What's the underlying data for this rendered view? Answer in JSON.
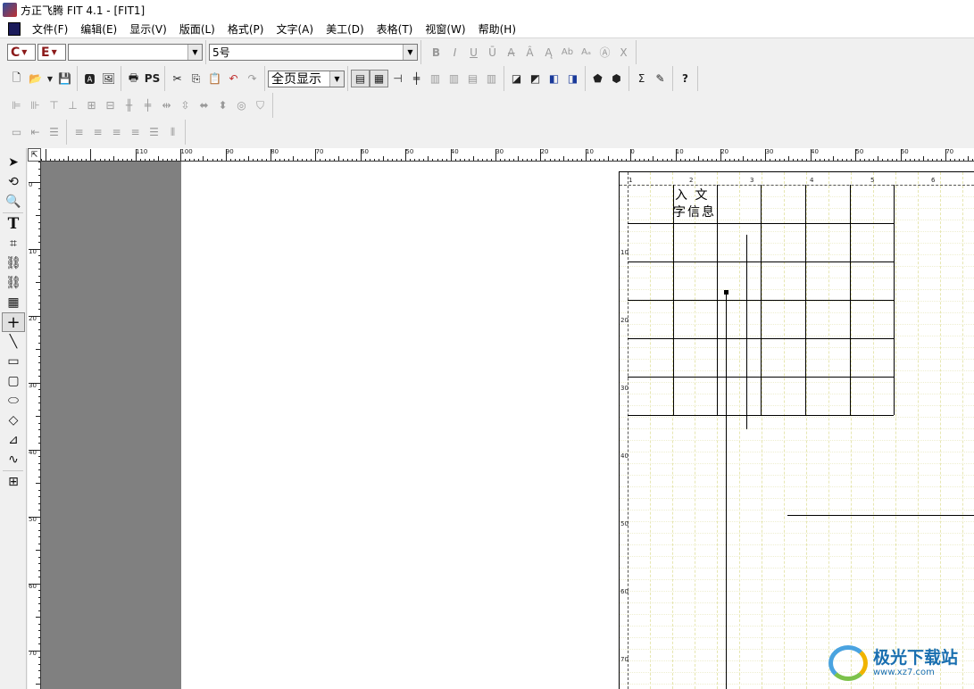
{
  "window": {
    "title": "方正飞腾 FIT 4.1 - [FIT1]"
  },
  "menu": [
    "文件(F)",
    "编辑(E)",
    "显示(V)",
    "版面(L)",
    "格式(P)",
    "文字(A)",
    "美工(D)",
    "表格(T)",
    "视窗(W)",
    "帮助(H)"
  ],
  "format_bar": {
    "lang_c": "C",
    "lang_e": "E",
    "font_name": "",
    "font_size": "5号",
    "style_buttons": [
      "B",
      "I",
      "U",
      "Ū",
      "A̶",
      "Â",
      "Ą",
      "Ab",
      "Aₐ",
      "Ⓐ",
      "X"
    ]
  },
  "main_bar": {
    "ps_label": "PS",
    "view_mode": "全页显示"
  },
  "table_text": [
    "入 文",
    "字信息"
  ],
  "hruler_labels": [
    "110",
    "100",
    "90",
    "80",
    "70",
    "60",
    "50",
    "40",
    "30",
    "20",
    "10",
    "0",
    "10",
    "20",
    "30",
    "40",
    "50",
    "60",
    "70"
  ],
  "vruler_labels": [
    "0",
    "10",
    "20",
    "30",
    "40",
    "50",
    "60",
    "70"
  ],
  "page_hruler_labels": [
    "1",
    "2",
    "3",
    "4",
    "5",
    "6"
  ],
  "page_vruler_labels": [
    "10",
    "20",
    "30",
    "40",
    "50",
    "60",
    "70"
  ],
  "watermark": {
    "main": "极光下载站",
    "sub": "www.xz7.com"
  }
}
